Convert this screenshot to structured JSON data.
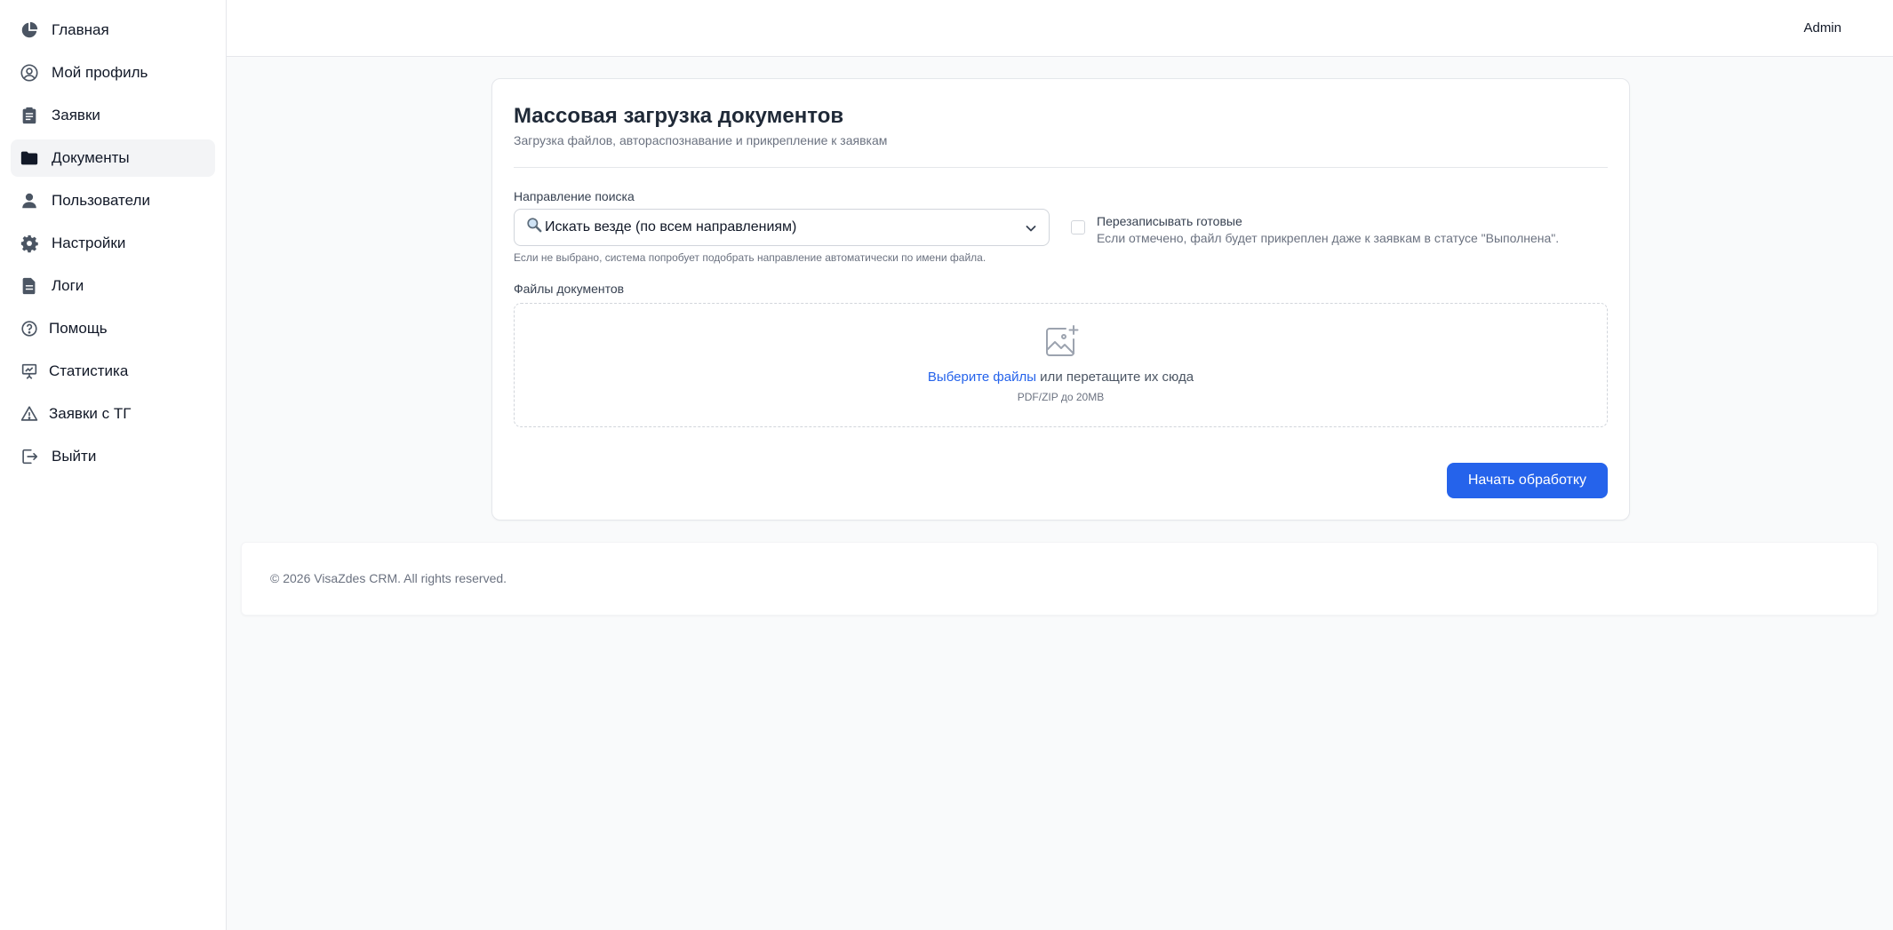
{
  "sidebar": {
    "items": [
      {
        "label": "Главная",
        "icon": "pie-chart-icon"
      },
      {
        "label": "Мой профиль",
        "icon": "user-circle-icon"
      },
      {
        "label": "Заявки",
        "icon": "clipboard-icon"
      },
      {
        "label": "Документы",
        "icon": "folder-icon",
        "active": true
      },
      {
        "label": "Пользователи",
        "icon": "user-icon"
      },
      {
        "label": "Настройки",
        "icon": "gear-icon"
      },
      {
        "label": "Логи",
        "icon": "document-icon"
      },
      {
        "label": "Помощь",
        "icon": "question-circle-icon"
      },
      {
        "label": "Статистика",
        "icon": "presentation-chart-icon"
      },
      {
        "label": "Заявки с ТГ",
        "icon": "warning-triangle-icon"
      },
      {
        "label": "Выйти",
        "icon": "logout-icon"
      }
    ]
  },
  "topbar": {
    "user": "Admin"
  },
  "card": {
    "title": "Массовая загрузка документов",
    "subtitle": "Загрузка файлов, автораспознавание и прикрепление к заявкам",
    "direction_label": "Направление поиска",
    "direction_value": "Искать везде (по всем направлениям)",
    "direction_hint": "Если не выбрано, система попробует подобрать направление автоматически по имени файла.",
    "overwrite_title": "Перезаписывать готовые",
    "overwrite_desc": "Если отмечено, файл будет прикреплен даже к заявкам в статусе \"Выполнена\".",
    "overwrite_checked": false,
    "files_label": "Файлы документов",
    "dropzone_link": "Выберите файлы",
    "dropzone_text": " или перетащите их сюда",
    "dropzone_sub": "PDF/ZIP до 20MB",
    "submit_label": "Начать обработку"
  },
  "footer": {
    "text": "© 2026 VisaZdes CRM. All rights reserved."
  },
  "colors": {
    "accent": "#2563eb",
    "active_bg": "#f3f4f6",
    "page_bg": "#f9fafb"
  }
}
